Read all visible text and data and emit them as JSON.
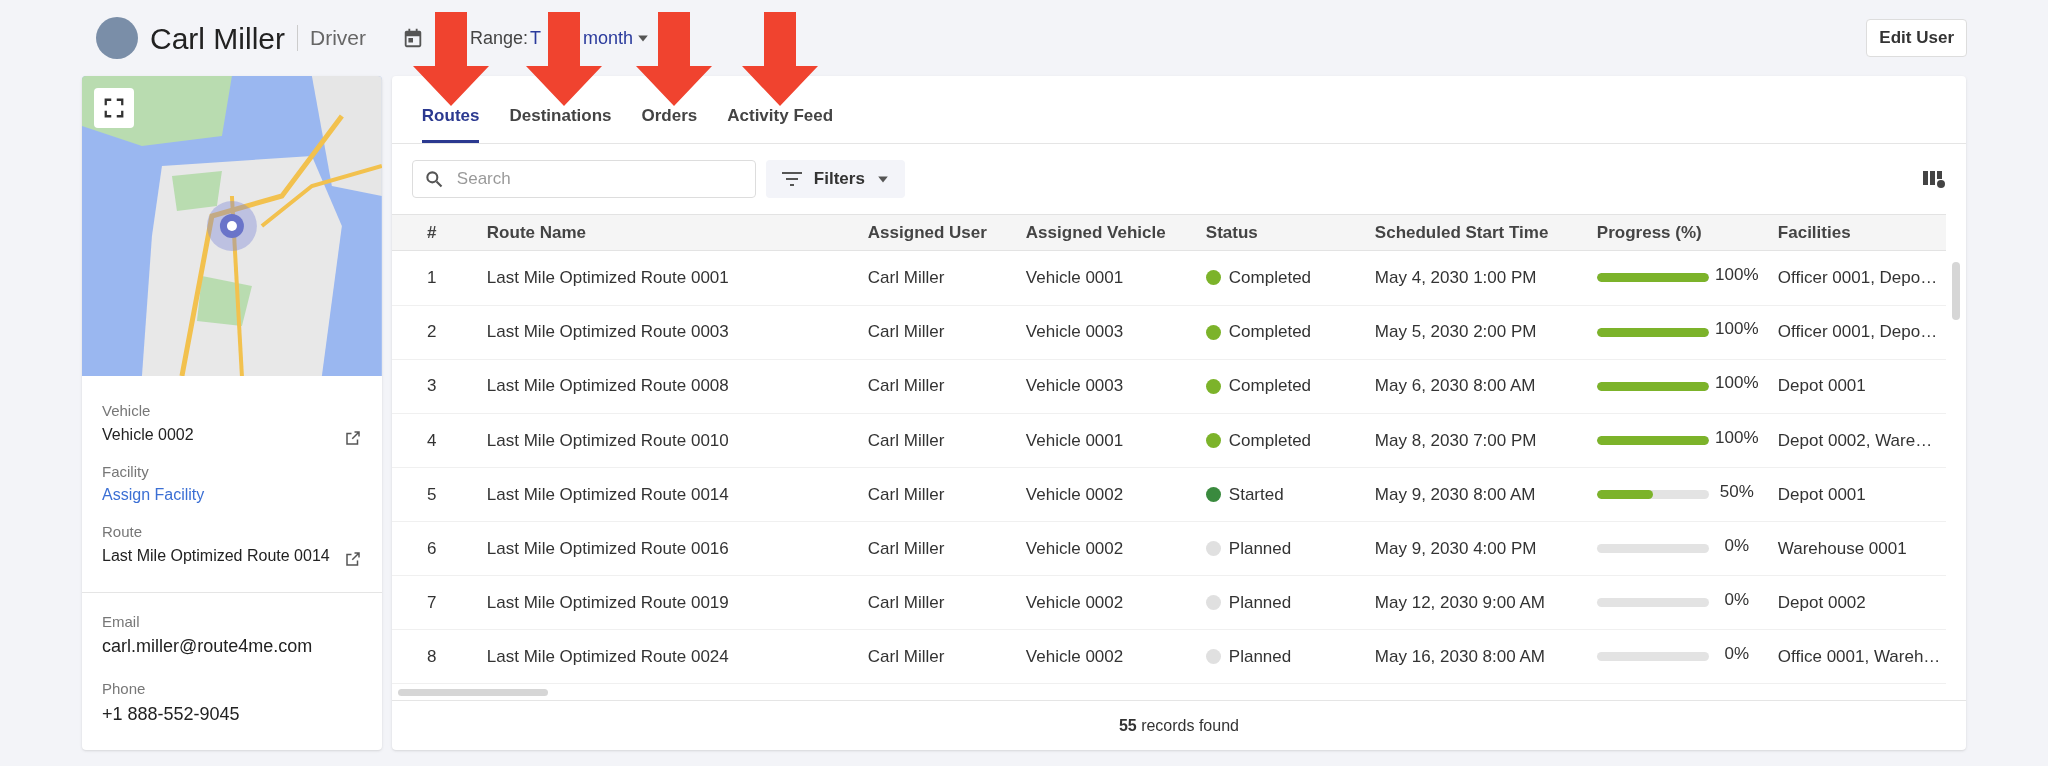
{
  "header": {
    "name": "Carl Miller",
    "role": "Driver",
    "date_range": {
      "label": "Range:",
      "value_parts": [
        "T",
        "month"
      ]
    },
    "edit_button": "Edit User"
  },
  "profile": {
    "fields": [
      {
        "label": "Vehicle",
        "value": "Vehicle 0002",
        "kind": "linked"
      },
      {
        "label": "Facility",
        "value": "Assign Facility",
        "kind": "link"
      },
      {
        "label": "Route",
        "value": "Last Mile Optimized Route 0014",
        "kind": "linked"
      }
    ],
    "contact": [
      {
        "label": "Email",
        "value": "carl.miller@route4me.com"
      },
      {
        "label": "Phone",
        "value": "+1 888-552-9045"
      }
    ]
  },
  "tabs": [
    {
      "label": "Routes",
      "selected": true
    },
    {
      "label": "Destinations",
      "selected": false
    },
    {
      "label": "Orders",
      "selected": false
    },
    {
      "label": "Activity Feed",
      "selected": false
    }
  ],
  "search": {
    "placeholder": "Search"
  },
  "filters_button": "Filters",
  "table": {
    "columns": [
      "#",
      "Route Name",
      "Assigned User",
      "Assigned Vehicle",
      "Status",
      "Scheduled Start Time",
      "Progress (%)",
      "Facilities"
    ],
    "rows": [
      {
        "index": "1",
        "route": "Last Mile Optimized Route 0001",
        "user": "Carl Miller",
        "vehicle": "Vehicle 0001",
        "status": "Completed",
        "color": "#7cb32a",
        "start": "May 4, 2030 1:00 PM",
        "level": 1,
        "progress": "100%",
        "facilities": "Officer 0001, Depo…"
      },
      {
        "index": "2",
        "route": "Last Mile Optimized Route 0003",
        "user": "Carl Miller",
        "vehicle": "Vehicle 0003",
        "status": "Completed",
        "color": "#7cb32a",
        "start": "May 5, 2030 2:00 PM",
        "level": 1,
        "progress": "100%",
        "facilities": "Officer 0001, Depo…"
      },
      {
        "index": "3",
        "route": "Last Mile Optimized Route 0008",
        "user": "Carl Miller",
        "vehicle": "Vehicle 0003",
        "status": "Completed",
        "color": "#7cb32a",
        "start": "May 6, 2030 8:00 AM",
        "level": 1,
        "progress": "100%",
        "facilities": "Depot 0001"
      },
      {
        "index": "4",
        "route": "Last Mile Optimized Route 0010",
        "user": "Carl Miller",
        "vehicle": "Vehicle 0001",
        "status": "Completed",
        "color": "#7cb32a",
        "start": "May 8, 2030 7:00 PM",
        "level": 1,
        "progress": "100%",
        "facilities": "Depot 0002, Ware…"
      },
      {
        "index": "5",
        "route": "Last Mile Optimized Route 0014",
        "user": "Carl Miller",
        "vehicle": "Vehicle 0002",
        "status": "Started",
        "color": "#3a8a3e",
        "start": "May 9, 2030 8:00 AM",
        "level": 0.5,
        "progress": "50%",
        "facilities": "Depot 0001"
      },
      {
        "index": "6",
        "route": "Last Mile Optimized Route 0016",
        "user": "Carl Miller",
        "vehicle": "Vehicle 0002",
        "status": "Planned",
        "color": "#e0e0e0",
        "start": "May 9, 2030 4:00 PM",
        "level": 0,
        "progress": "0%",
        "facilities": "Warehouse 0001"
      },
      {
        "index": "7",
        "route": "Last Mile Optimized Route 0019",
        "user": "Carl Miller",
        "vehicle": "Vehicle 0002",
        "status": "Planned",
        "color": "#e0e0e0",
        "start": "May 12, 2030 9:00 AM",
        "level": 0,
        "progress": "0%",
        "facilities": "Depot 0002"
      },
      {
        "index": "8",
        "route": "Last Mile Optimized Route 0024",
        "user": "Carl Miller",
        "vehicle": "Vehicle 0002",
        "status": "Planned",
        "color": "#e0e0e0",
        "start": "May 16, 2030 8:00 AM",
        "level": 0,
        "progress": "0%",
        "facilities": "Office 0001, Wareh…"
      }
    ]
  },
  "footer": {
    "count": "55",
    "text": "records found"
  }
}
